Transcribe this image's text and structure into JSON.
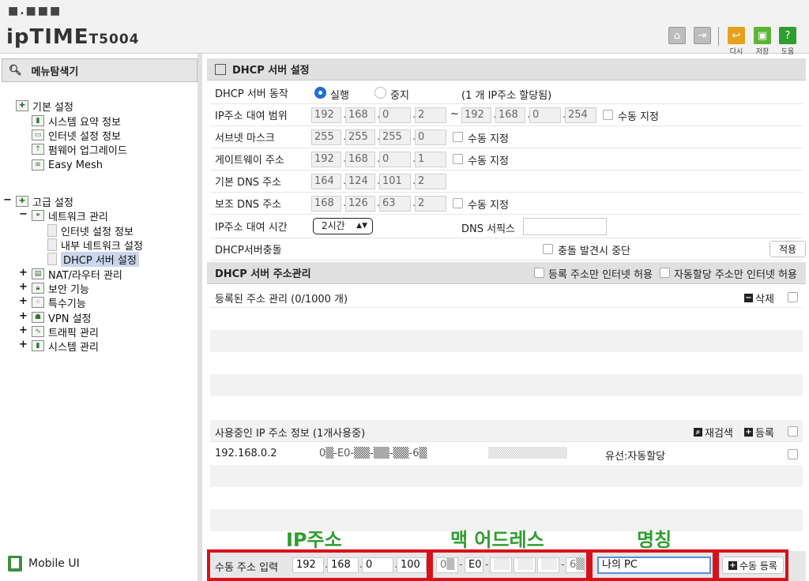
{
  "header": {
    "brand_dots": "■.■■■",
    "brand_name": "ipTIME",
    "model": "T5004",
    "buttons": [
      {
        "label": "다시",
        "icon": "back-icon",
        "color": "#e7a11a"
      },
      {
        "label": "저장",
        "icon": "save-icon",
        "color": "#5bb534"
      },
      {
        "label": "도움",
        "icon": "help-icon",
        "color": "#2f9e2f"
      }
    ]
  },
  "sidebar": {
    "title": "메뉴탐색기",
    "basic": {
      "label": "기본 설정",
      "items": [
        "시스템 요약 정보",
        "인터넷 설정 정보",
        "펌웨어 업그레이드",
        "Easy Mesh"
      ]
    },
    "advanced": {
      "expander": "−",
      "label": "고급 설정",
      "network": {
        "expander": "−",
        "label": "네트워크 관리",
        "items": [
          "인터넷 설정 정보",
          "내부 네트워크 설정",
          "DHCP 서버 설정"
        ]
      },
      "items": [
        {
          "expander": "+",
          "label": "NAT/라우터 관리"
        },
        {
          "expander": "+",
          "label": "보안 기능"
        },
        {
          "expander": "+",
          "label": "특수기능"
        },
        {
          "expander": "+",
          "label": "VPN 설정"
        },
        {
          "expander": "+",
          "label": "트래픽 관리"
        },
        {
          "expander": "+",
          "label": "시스템 관리"
        }
      ]
    },
    "mobile_ui": "Mobile UI"
  },
  "dhcp": {
    "title": "DHCP 서버 설정",
    "operation": {
      "label": "DHCP 서버 동작",
      "run": "실행",
      "stop": "중지",
      "note": "(1 개 IP주소 할당됨)",
      "selected": "run"
    },
    "range": {
      "label": "IP주소 대여 범위",
      "start": [
        "192",
        "168",
        "0",
        "2"
      ],
      "separator": "~",
      "end": [
        "192",
        "168",
        "0",
        "254"
      ],
      "manual": "수동 지정"
    },
    "subnet": {
      "label": "서브넷 마스크",
      "value": [
        "255",
        "255",
        "255",
        "0"
      ],
      "manual": "수동 지정"
    },
    "gateway": {
      "label": "게이트웨이 주소",
      "value": [
        "192",
        "168",
        "0",
        "1"
      ],
      "manual": "수동 지정"
    },
    "dns1": {
      "label": "기본 DNS 주소",
      "value": [
        "164",
        "124",
        "101",
        "2"
      ]
    },
    "dns2": {
      "label": "보조 DNS 주소",
      "value": [
        "168",
        "126",
        "63",
        "2"
      ],
      "manual": "수동 지정"
    },
    "lease": {
      "label": "IP주소 대여 시간",
      "value": "2시간",
      "dns_suffix_label": "DNS 서픽스",
      "dns_suffix_value": ""
    },
    "conflict": {
      "label": "DHCP서버충돌",
      "stop_label": "충돌 발견시 중단",
      "apply": "적용"
    }
  },
  "address_mgmt": {
    "title": "DHCP 서버 주소관리",
    "opt1": "등록 주소만 인터넷 허용",
    "opt2": "자동할당 주소만 인터넷 허용",
    "registered": {
      "label": "등록된 주소 관리 (0/1000 개)",
      "delete": "삭제"
    },
    "inuse": {
      "label": "사용중인 IP 주소 정보 (1개사용중)",
      "rescan": "재검색",
      "register": "등록",
      "rows": [
        {
          "ip": "192.168.0.2",
          "mac": "0▒-E0-▒▒-▒▒-▒▒-6▒",
          "name": "▒▒▒▒▒▒▒▒▒▒",
          "type": "유선:자동할당"
        }
      ]
    }
  },
  "manual_input": {
    "label": "수동 주소 입력",
    "ip": [
      "192",
      "168",
      "0",
      "100"
    ],
    "mac": [
      "0▒",
      "E0",
      "▒▒",
      "▒▒",
      "▒▒",
      "6▒"
    ],
    "name": "나의 PC",
    "button": "수동 등록"
  },
  "annotations": {
    "ip_label": "IP주소",
    "mac_label": "맥 어드레스",
    "name_label": "명칭",
    "color": "#2f9e2f",
    "box_color": "#d8101a"
  }
}
